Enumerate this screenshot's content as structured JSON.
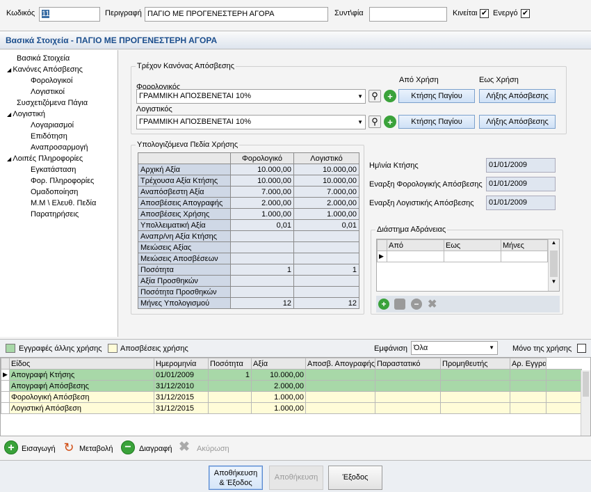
{
  "header": {
    "code_label": "Κωδικός",
    "code_value": "11",
    "desc_label": "Περιγραφή",
    "desc_value": "ΠΑΓΙΟ ΜΕ ΠΡΟΓΕΝΕΣΤΕΡΗ ΑΓΟΡΑ",
    "synt_label": "Συντ\\φία",
    "synt_value": "",
    "kinitai_label": "Κινείται",
    "energo_label": "Ενεργό",
    "check_mark": "✔"
  },
  "section_title": "Βασικά Στοιχεία - ΠΑΓΙΟ ΜΕ ΠΡΟΓΕΝΕΣΤΕΡΗ ΑΓΟΡΑ",
  "tree": [
    "Βασικά Στοιχεία",
    "Κανόνες Απόσβεσης",
    "Φορολογικοί",
    "Λογιστικοί",
    "Συσχετιζόμενα Πάγια",
    "Λογιστική",
    "Λογαριασμοί",
    "Επιδότηση",
    "Αναπροσαρμογή",
    "Λοιπές Πληροφορίες",
    "Εγκατάσταση",
    "Φορ. Πληροφορίες",
    "Ομαδοποίηση",
    "Μ.Μ \\ Ελευθ. Πεδία",
    "Παρατηρήσεις"
  ],
  "rules": {
    "title": "Τρέχον Κανόνας Απόσβεσης",
    "apo_label": "Από Χρήση",
    "eos_label": "Εως Χρήση",
    "tax_label": "Φορολογικός",
    "tax_value": "ΓΡΑΜΜΙΚΗ ΑΠΟΣΒΕΝΕΤΑΙ 10%",
    "acc_label": "Λογιστικός",
    "acc_value": "ΓΡΑΜΜΙΚΗ ΑΠΟΣΒΕΝΕΤΑΙ 10%",
    "ktisis_btn": "Κτήσης Παγίου",
    "lixis_btn": "Λήξης Απόσβεσης"
  },
  "calc": {
    "title": "Υπολογιζόμενα Πεδία Χρήσης",
    "col1": "Φορολογικό",
    "col2": "Λογιστικό",
    "rows": [
      [
        "Αρχική Αξία",
        "10.000,00",
        "10.000,00"
      ],
      [
        "Τρέχουσα Αξία Κτήσης",
        "10.000,00",
        "10.000,00"
      ],
      [
        "Αναπόσβεστη Αξία",
        "7.000,00",
        "7.000,00"
      ],
      [
        "Αποσβέσεις Απογραφής",
        "2.000,00",
        "2.000,00"
      ],
      [
        "Αποσβέσεις Χρήσης",
        "1.000,00",
        "1.000,00"
      ],
      [
        "Υπολλειματική Αξία",
        "0,01",
        "0,01"
      ],
      [
        "Αναπρ/νη Αξία Κτήσης",
        "",
        ""
      ],
      [
        "Μειώσεις Αξίας",
        "",
        ""
      ],
      [
        "Μειώσεις Αποσβέσεων",
        "",
        ""
      ],
      [
        "Ποσότητα",
        "1",
        "1"
      ],
      [
        "Αξία Προσθηκών",
        "",
        ""
      ],
      [
        "Ποσότητα Προσθηκών",
        "",
        ""
      ],
      [
        "Μήνες Υπολογισμού",
        "12",
        "12"
      ]
    ]
  },
  "dates": {
    "ktisi_label": "Ημ\\νία Κτήσης",
    "ktisi_value": "01/01/2009",
    "forol_label": "Εναρξη Φορολογικής  Απόσβεσης",
    "forol_value": "01/01/2009",
    "logist_label": "Εναρξη Λογιστικής Απόσβεσης",
    "logist_value": "01/01/2009"
  },
  "idle": {
    "title": "Διάστημα Αδράνειας",
    "cols": [
      "Από",
      "Εως",
      "Μήνες"
    ]
  },
  "filter": {
    "other_label": "Εγγραφές άλλης χρήσης",
    "depr_label": "Αποσβέσεις χρήσης",
    "show_label": "Εμφάνιση",
    "show_value": "Όλα",
    "only_label": "Μόνο της χρήσης"
  },
  "grid": {
    "cols": [
      "Είδος",
      "Ημερομηνία",
      "Ποσότητα",
      "Αξία",
      "Αποσβ. Απογραφής",
      "Παραστατικό",
      "Προμηθευτής",
      "Αρ. Εγγραφής"
    ],
    "rows": [
      [
        "Απογραφή Κτήσης",
        "01/01/2009",
        "1",
        "10.000,00",
        "",
        "",
        "",
        ""
      ],
      [
        "Απογραφή Απόσβεσης",
        "31/12/2010",
        "",
        "2.000,00",
        "",
        "",
        "",
        ""
      ],
      [
        "Φορολογική Απόσβεση",
        "31/12/2015",
        "",
        "1.000,00",
        "",
        "",
        "",
        ""
      ],
      [
        "Λογιστική Απόσβεση",
        "31/12/2015",
        "",
        "1.000,00",
        "",
        "",
        "",
        ""
      ]
    ]
  },
  "actions": {
    "insert": "Εισαγωγή",
    "change": "Μεταβολή",
    "delete": "Διαγραφή",
    "cancel": "Ακύρωση"
  },
  "footer": {
    "save_exit_1": "Αποθήκευση",
    "save_exit_2": "& Έξοδος",
    "save": "Αποθήκευση",
    "exit": "Έξοδος"
  },
  "colors": {
    "green_row": "#a8d8a8",
    "yellow_row": "#fffcd8",
    "accent": "#1a4d8c"
  }
}
